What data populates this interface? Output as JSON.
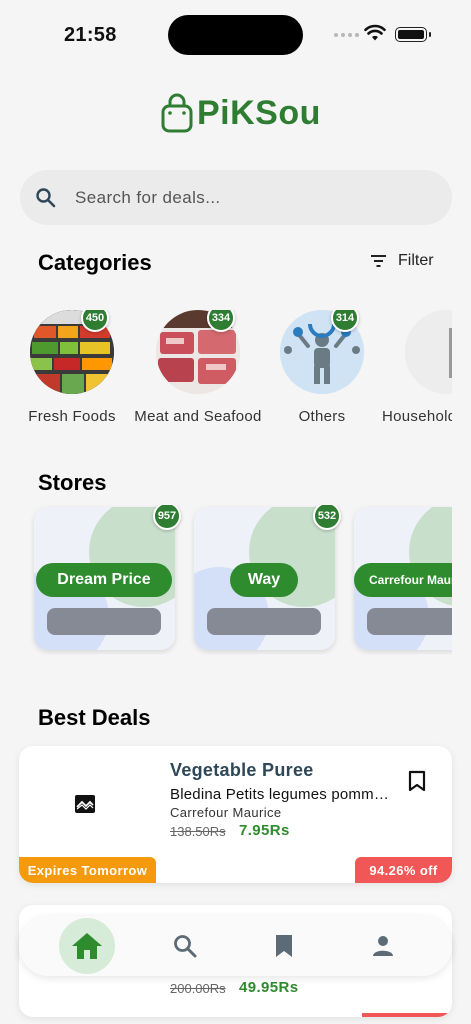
{
  "status_bar": {
    "time": "21:58"
  },
  "app": {
    "logo_text": "PiKSou",
    "brand_color": "#2e7d32"
  },
  "search": {
    "placeholder": "Search for deals..."
  },
  "categories": {
    "title": "Categories",
    "filter_label": "Filter",
    "items": [
      {
        "label": "Fresh Foods",
        "count": "450"
      },
      {
        "label": "Meat and Seafood",
        "count": "334"
      },
      {
        "label": "Others",
        "count": "314"
      },
      {
        "label": "Household",
        "count": ""
      }
    ]
  },
  "stores": {
    "title": "Stores",
    "items": [
      {
        "name": "Dream Price",
        "count": "957"
      },
      {
        "name": "Way",
        "count": "532"
      },
      {
        "name": "Carrefour Maurice",
        "count": ""
      }
    ]
  },
  "best_deals": {
    "title": "Best Deals",
    "items": [
      {
        "title": "Vegetable Puree",
        "subtitle": "Bledina Petits legumes pomme de terre",
        "store": "Carrefour Maurice",
        "old_price": "138.50Rs",
        "new_price": "7.95Rs",
        "expires": "Expires Tomorrow",
        "discount": "94.26% off"
      },
      {
        "old_price": "200.00Rs",
        "new_price": "49.95Rs"
      }
    ]
  },
  "bottom_nav": {
    "items": [
      {
        "icon": "home-icon",
        "active": true
      },
      {
        "icon": "search-icon",
        "active": false
      },
      {
        "icon": "bookmark-icon",
        "active": false
      },
      {
        "icon": "person-icon",
        "active": false
      }
    ]
  }
}
